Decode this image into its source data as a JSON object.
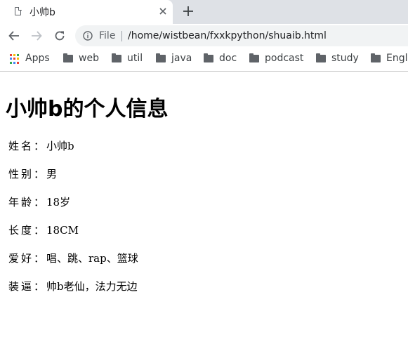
{
  "tab": {
    "title": "小帅b"
  },
  "address_bar": {
    "scheme_label": "File",
    "url": "/home/wistbean/fxxkpython/shuaib.html"
  },
  "bookmarks": [
    {
      "label": "Apps",
      "icon": "apps-icon"
    },
    {
      "label": "web",
      "icon": "folder-icon"
    },
    {
      "label": "util",
      "icon": "folder-icon"
    },
    {
      "label": "java",
      "icon": "folder-icon"
    },
    {
      "label": "doc",
      "icon": "folder-icon"
    },
    {
      "label": "podcast",
      "icon": "folder-icon"
    },
    {
      "label": "study",
      "icon": "folder-icon"
    },
    {
      "label": "Engl",
      "icon": "folder-icon"
    }
  ],
  "page": {
    "heading": "小帅b的个人信息",
    "rows": [
      {
        "key": "姓名：",
        "value": "小帅b"
      },
      {
        "key": "性别：",
        "value": "男"
      },
      {
        "key": "年龄：",
        "value": "18岁"
      },
      {
        "key": "长度：",
        "value": "18CM"
      },
      {
        "key": "爱好：",
        "value": "唱、跳、rap、篮球"
      },
      {
        "key": "装逼：",
        "value": "帅b老仙，法力无边"
      }
    ]
  },
  "colors": {
    "tabstrip_bg": "#dee1e6",
    "omnibox_bg": "#f1f3f4",
    "icon_gray": "#5f6368",
    "apps_dots": [
      "#ea4335",
      "#fbbc05",
      "#34a853",
      "#4285f4",
      "#ea4335",
      "#fbbc05",
      "#34a853",
      "#4285f4",
      "#ea4335"
    ]
  }
}
